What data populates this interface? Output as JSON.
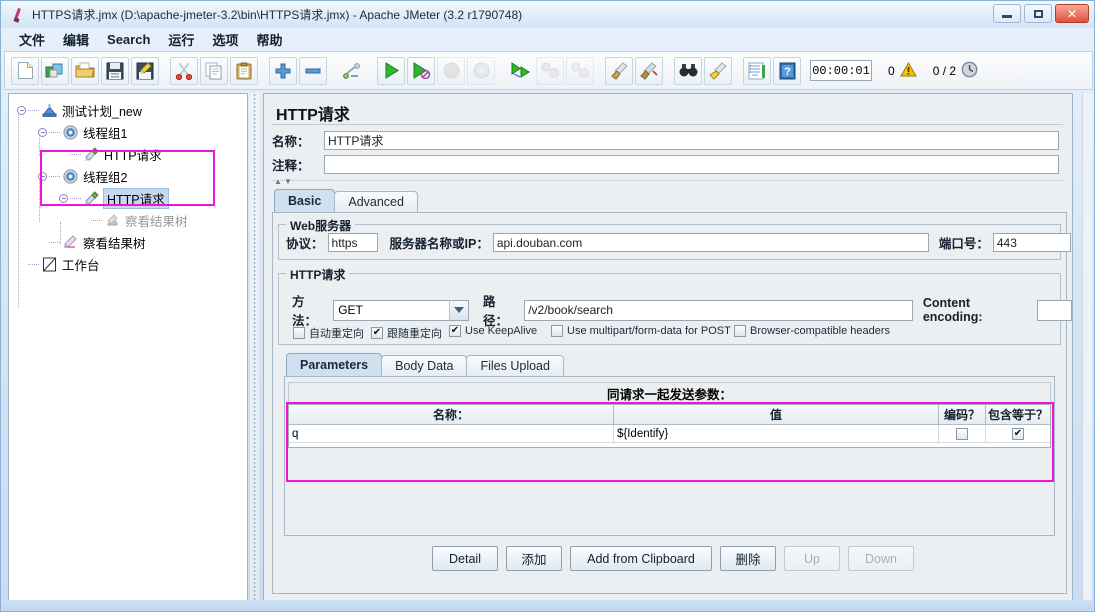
{
  "window": {
    "title": "HTTPS请求.jmx (D:\\apache-jmeter-3.2\\bin\\HTTPS请求.jmx) - Apache JMeter (3.2 r1790748)",
    "app_icon": "jmeter-feather-icon",
    "minimize_label": "—",
    "maximize_label": "□",
    "close_label": "✕"
  },
  "menubar": {
    "items": [
      {
        "label": "文件",
        "name": "menu-file"
      },
      {
        "label": "编辑",
        "name": "menu-edit"
      },
      {
        "label": "Search",
        "name": "menu-search"
      },
      {
        "label": "运行",
        "name": "menu-run"
      },
      {
        "label": "选项",
        "name": "menu-options"
      },
      {
        "label": "帮助",
        "name": "menu-help"
      }
    ]
  },
  "toolbar": {
    "buttons": [
      {
        "name": "new-icon",
        "icon": "new-document"
      },
      {
        "name": "templates-icon",
        "icon": "templates"
      },
      {
        "name": "open-icon",
        "icon": "open-folder"
      },
      {
        "name": "save-icon",
        "icon": "floppy-save"
      },
      {
        "name": "save-as-icon",
        "icon": "save-as-pencil"
      },
      {
        "name": "cut-icon",
        "icon": "scissors"
      },
      {
        "name": "copy-icon",
        "icon": "copy-pages"
      },
      {
        "name": "paste-icon",
        "icon": "clipboard"
      },
      {
        "name": "expand-all-icon",
        "icon": "plus"
      },
      {
        "name": "collapse-all-icon",
        "icon": "minus"
      },
      {
        "name": "toggle-icon",
        "icon": "toggle-switch"
      },
      {
        "name": "start-icon",
        "icon": "green-play"
      },
      {
        "name": "start-no-timers-icon",
        "icon": "green-play-no-timers"
      },
      {
        "name": "stop-icon",
        "icon": "gray-stop"
      },
      {
        "name": "shutdown-icon",
        "icon": "gray-shutdown"
      },
      {
        "name": "start-remote-icon",
        "icon": "remote-start"
      },
      {
        "name": "stop-remote-icon",
        "icon": "remote-stop"
      },
      {
        "name": "shutdown-remote-icon",
        "icon": "remote-shutdown"
      },
      {
        "name": "clear-icon",
        "icon": "broom-clear"
      },
      {
        "name": "clear-all-icon",
        "icon": "broom-clear-all"
      },
      {
        "name": "search-icon",
        "icon": "binoculars"
      },
      {
        "name": "reset-search-icon",
        "icon": "broom-yellow"
      },
      {
        "name": "function-helper-icon",
        "icon": "list-lines"
      },
      {
        "name": "help-icon",
        "icon": "blue-question-book"
      }
    ],
    "timer": "00:00:01",
    "warning_count": "0",
    "warning_icon": "warning-triangle",
    "thread_counter": "0 / 2",
    "clock_icon": "clock-icon"
  },
  "tree": {
    "nodes": [
      {
        "name": "tree-item-test-plan",
        "label": "测试计划_new",
        "icon": "test-plan-icon",
        "depth": 0,
        "selected": false,
        "dim": false
      },
      {
        "name": "tree-item-thread-group-1",
        "label": "线程组1",
        "icon": "thread-group-icon",
        "depth": 1,
        "selected": false,
        "dim": false
      },
      {
        "name": "tree-item-http-request-1",
        "label": "HTTP请求",
        "icon": "http-request-icon",
        "depth": 2,
        "selected": false,
        "dim": false
      },
      {
        "name": "tree-item-thread-group-2",
        "label": "线程组2",
        "icon": "thread-group-icon",
        "depth": 1,
        "selected": false,
        "dim": false
      },
      {
        "name": "tree-item-http-request-2",
        "label": "HTTP请求",
        "icon": "http-request-icon",
        "depth": 2,
        "selected": true,
        "dim": false
      },
      {
        "name": "tree-item-view-results-tree-nested",
        "label": "察看结果树",
        "icon": "view-results-tree-icon",
        "depth": 3,
        "selected": false,
        "dim": true
      },
      {
        "name": "tree-item-view-results-tree",
        "label": "察看结果树",
        "icon": "view-results-tree-icon",
        "depth": 1,
        "selected": false,
        "dim": false
      },
      {
        "name": "tree-item-workbench",
        "label": "工作台",
        "icon": "workbench-icon",
        "depth": 0,
        "selected": false,
        "dim": false
      }
    ]
  },
  "panel": {
    "title": "HTTP请求",
    "name_label": "名称：",
    "name_value": "HTTP请求",
    "comment_label": "注释：",
    "comment_value": "",
    "tabs": [
      {
        "label": "Basic",
        "name": "tab-basic",
        "active": true
      },
      {
        "label": "Advanced",
        "name": "tab-advanced",
        "active": false
      }
    ],
    "web_server": {
      "group_title": "Web服务器",
      "protocol_label": "协议：",
      "protocol_value": "https",
      "server_label": "服务器名称或IP：",
      "server_value": "api.douban.com",
      "port_label": "端口号：",
      "port_value": "443"
    },
    "http_request": {
      "group_title": "HTTP请求",
      "method_label": "方法：",
      "method_value": "GET",
      "path_label": "路径：",
      "path_value": "/v2/book/search",
      "content_encoding_label": "Content encoding:",
      "content_encoding_value": "",
      "checkboxes": [
        {
          "label": "自动重定向",
          "checked": false,
          "name": "checkbox-auto-redirect"
        },
        {
          "label": "跟随重定向",
          "checked": true,
          "name": "checkbox-follow-redirects"
        },
        {
          "label": "Use KeepAlive",
          "checked": true,
          "name": "checkbox-use-keepalive"
        },
        {
          "label": "Use multipart/form-data for POST",
          "checked": false,
          "name": "checkbox-multipart"
        },
        {
          "label": "Browser-compatible headers",
          "checked": false,
          "name": "checkbox-browser-compatible-headers"
        }
      ]
    },
    "inner_tabs": [
      {
        "label": "Parameters",
        "name": "tab-parameters",
        "active": true
      },
      {
        "label": "Body Data",
        "name": "tab-body-data",
        "active": false
      },
      {
        "label": "Files Upload",
        "name": "tab-files-upload",
        "active": false
      }
    ],
    "params_table": {
      "caption": "同请求一起发送参数：",
      "columns": [
        "名称：",
        "值",
        "编码？",
        "包含等于？"
      ],
      "rows": [
        {
          "name": "q",
          "value": "${Identify}",
          "encode": false,
          "include_equals": true
        }
      ]
    },
    "buttons": [
      {
        "label": "Detail",
        "name": "detail-button",
        "disabled": false
      },
      {
        "label": "添加",
        "name": "add-button",
        "disabled": false
      },
      {
        "label": "Add from Clipboard",
        "name": "add-from-clipboard-button",
        "disabled": false
      },
      {
        "label": "删除",
        "name": "delete-button",
        "disabled": false
      },
      {
        "label": "Up",
        "name": "up-button",
        "disabled": true
      },
      {
        "label": "Down",
        "name": "down-button",
        "disabled": true
      }
    ]
  },
  "colors": {
    "highlight": "#f015d8",
    "selection": "#c6d9ee",
    "accent": "#2e7d32"
  }
}
